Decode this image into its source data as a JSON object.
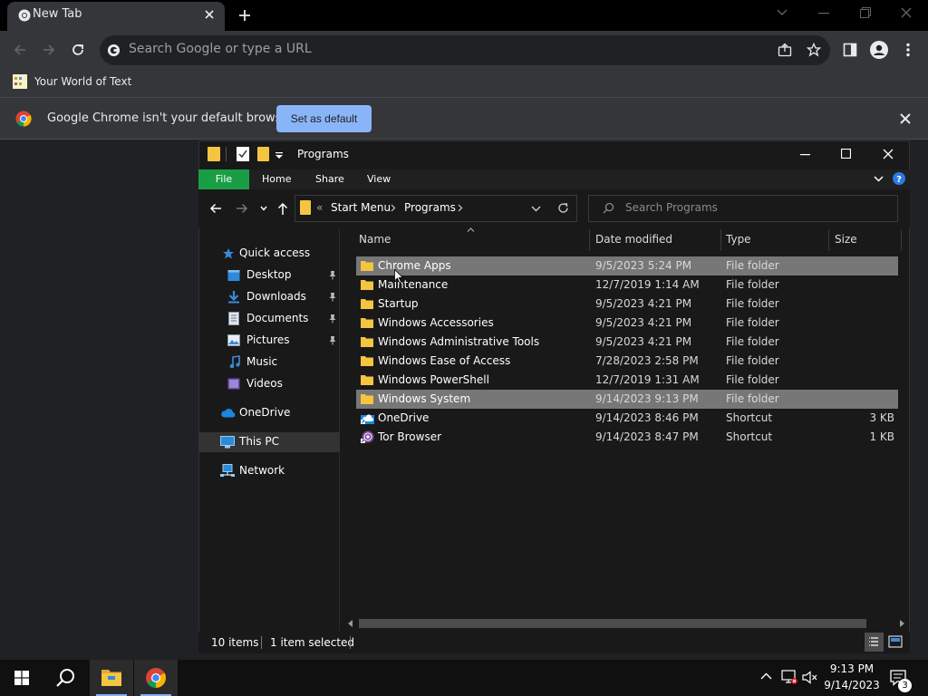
{
  "browser": {
    "tab_title": "New Tab",
    "omnibox_placeholder": "Search Google or type a URL",
    "bookmark": "Your World of Text",
    "infobar_text": "Google Chrome isn't your default browser",
    "set_default_label": "Set as default"
  },
  "explorer": {
    "title": "Programs",
    "ribbon_tabs": [
      "File",
      "Home",
      "Share",
      "View"
    ],
    "breadcrumb": [
      "Start Menu",
      "Programs"
    ],
    "search_placeholder": "Search Programs",
    "nav": [
      {
        "label": "Quick access",
        "icon": "star-icon"
      },
      {
        "label": "Desktop",
        "icon": "desktop-icon",
        "pinned": true
      },
      {
        "label": "Downloads",
        "icon": "download-icon",
        "pinned": true
      },
      {
        "label": "Documents",
        "icon": "documents-icon",
        "pinned": true
      },
      {
        "label": "Pictures",
        "icon": "pictures-icon",
        "pinned": true
      },
      {
        "label": "Music",
        "icon": "music-icon"
      },
      {
        "label": "Videos",
        "icon": "videos-icon"
      },
      {
        "label": "OneDrive",
        "icon": "cloud-icon"
      },
      {
        "label": "This PC",
        "icon": "computer-icon"
      },
      {
        "label": "Network",
        "icon": "network-icon"
      }
    ],
    "columns": [
      "Name",
      "Date modified",
      "Type",
      "Size"
    ],
    "files": [
      {
        "name": "Chrome Apps",
        "date": "9/5/2023 5:24 PM",
        "type": "File folder",
        "size": ""
      },
      {
        "name": "Maintenance",
        "date": "12/7/2019 1:14 AM",
        "type": "File folder",
        "size": ""
      },
      {
        "name": "Startup",
        "date": "9/5/2023 4:21 PM",
        "type": "File folder",
        "size": ""
      },
      {
        "name": "Windows Accessories",
        "date": "9/5/2023 4:21 PM",
        "type": "File folder",
        "size": ""
      },
      {
        "name": "Windows Administrative Tools",
        "date": "9/5/2023 4:21 PM",
        "type": "File folder",
        "size": ""
      },
      {
        "name": "Windows Ease of Access",
        "date": "7/28/2023 2:58 PM",
        "type": "File folder",
        "size": ""
      },
      {
        "name": "Windows PowerShell",
        "date": "12/7/2019 1:31 AM",
        "type": "File folder",
        "size": ""
      },
      {
        "name": "Windows System",
        "date": "9/14/2023 9:13 PM",
        "type": "File folder",
        "size": ""
      },
      {
        "name": "OneDrive",
        "date": "9/14/2023 8:46 PM",
        "type": "Shortcut",
        "size": "3 KB"
      },
      {
        "name": "Tor Browser",
        "date": "9/14/2023 8:47 PM",
        "type": "Shortcut",
        "size": "1 KB"
      }
    ],
    "status_items": "10 items",
    "status_selected": "1 item selected"
  },
  "taskbar": {
    "time": "9:13 PM",
    "date": "9/14/2023",
    "notification_count": "3"
  },
  "colors": {
    "chrome_dark": "#35363a",
    "accent_blue": "#8ab4f8",
    "file_tab_green": "#1a9e45",
    "folder_yellow": "#f5c542",
    "selection_gray": "#777777"
  }
}
